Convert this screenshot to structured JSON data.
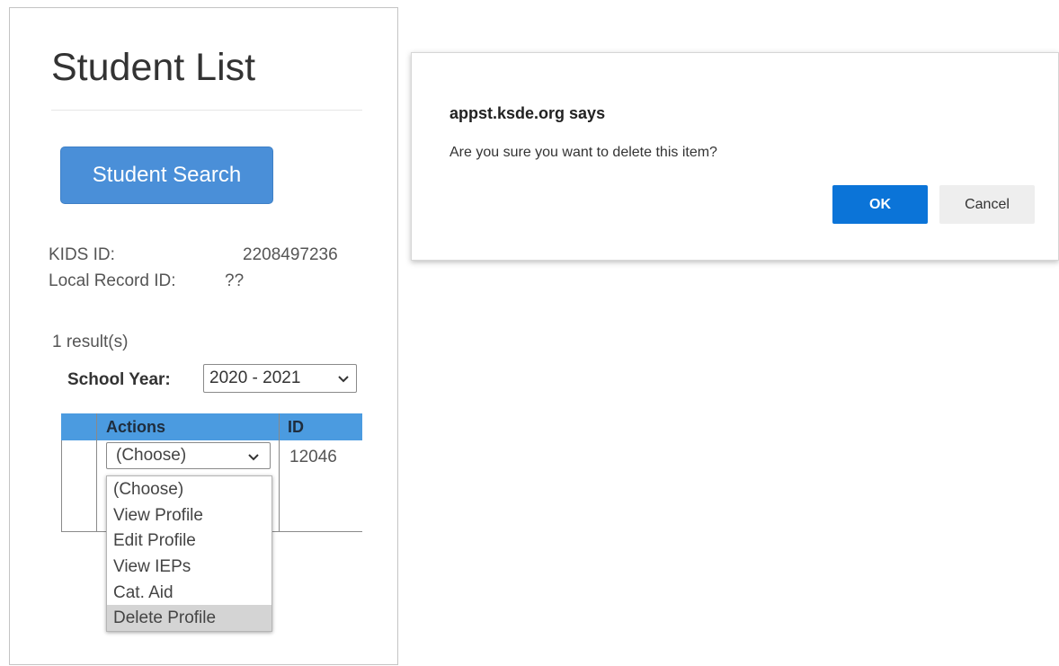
{
  "student_panel": {
    "title": "Student List",
    "search_button_label": "Student Search",
    "kids_id_label": "KIDS ID:",
    "kids_id_value": "2208497236",
    "local_record_label": "Local Record ID:",
    "local_record_value": "??",
    "results_count": "1 result(s)",
    "school_year_label": "School Year:",
    "school_year_selected": "2020 - 2021",
    "table": {
      "columns": [
        "Actions",
        "ID"
      ],
      "row": {
        "action_selected": "(Choose)",
        "id": "12046"
      }
    },
    "action_options": [
      "(Choose)",
      "View Profile",
      "Edit Profile",
      "View IEPs",
      "Cat. Aid",
      "Delete Profile"
    ],
    "highlighted_option": "Delete Profile"
  },
  "dialog": {
    "title": "appst.ksde.org says",
    "message": "Are you sure you want to delete this item?",
    "ok_label": "OK",
    "cancel_label": "Cancel"
  },
  "colors": {
    "search_button": "#4a8fd8",
    "table_header": "#4b9be0",
    "ok_button": "#0b74d8",
    "cancel_button": "#eeeeee",
    "highlight": "#d4d4d4"
  },
  "icons": {
    "select_arrow": "chevron-down-icon"
  }
}
